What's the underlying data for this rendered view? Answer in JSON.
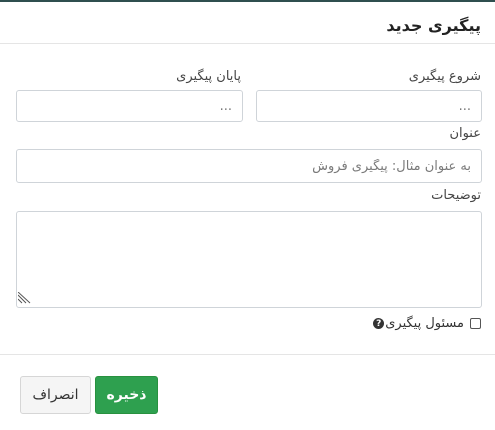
{
  "modal": {
    "title": "پیگیری جدید"
  },
  "form": {
    "start": {
      "label": "شروع پیگیری",
      "value": "..."
    },
    "end": {
      "label": "پایان پیگیری",
      "value": "..."
    },
    "subject": {
      "label": "عنوان",
      "placeholder": "به عنوان مثال: پیگیری فروش"
    },
    "description": {
      "label": "توضیحات",
      "value": ""
    },
    "responsible": {
      "label": "مسئول پیگیری",
      "checked": false,
      "help_icon": "question-circle-icon"
    }
  },
  "footer": {
    "save_label": "ذخیره",
    "cancel_label": "انصراف"
  },
  "colors": {
    "save_button": "#2ea04f",
    "cancel_button": "#f5f5f5",
    "top_border": "#2f4f4f"
  }
}
